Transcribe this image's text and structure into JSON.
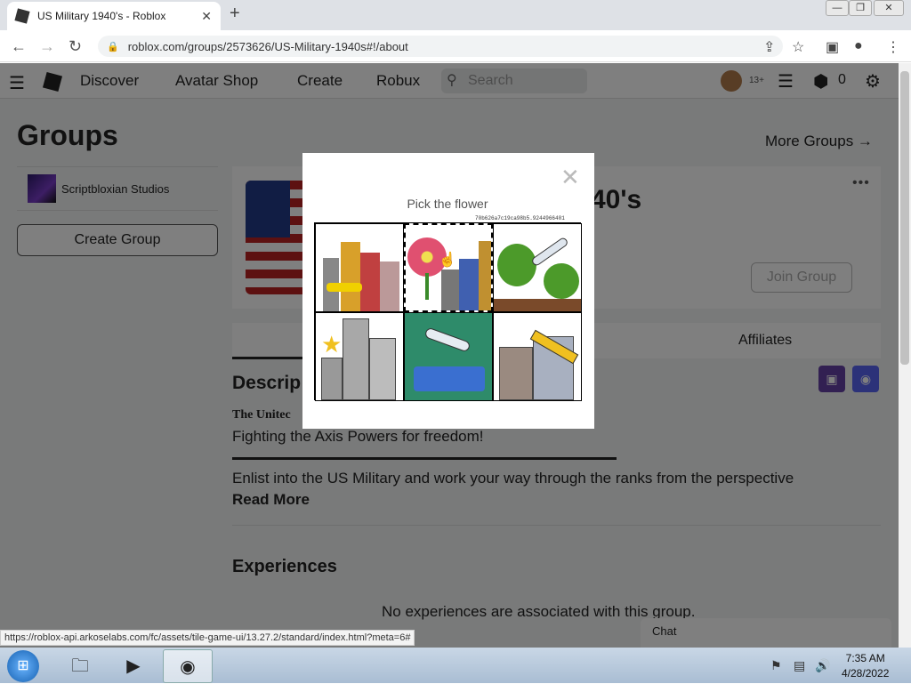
{
  "browser": {
    "tab_title": "US Military 1940's - Roblox",
    "url": "roblox.com/groups/2573626/US-Military-1940s#!/about",
    "status_url": "https://roblox-api.arkoselabs.com/fc/assets/tile-game-ui/13.27.2/standard/index.html?meta=6#"
  },
  "nav": {
    "items": [
      "Discover",
      "Avatar Shop",
      "Create",
      "Robux"
    ],
    "search_placeholder": "Search",
    "age_badge": "13+",
    "robux_count": "0"
  },
  "page": {
    "title": "Groups",
    "more_groups": "More Groups →",
    "sidebar_group": "Scriptbloxian Studios",
    "create_group": "Create Group",
    "group_name_partial": "40's",
    "join_group": "Join Group",
    "affiliates_tab": "Affiliates",
    "description_heading": "Descrip",
    "description_bold": "The Unitec",
    "description_line1": "Fighting the Axis Powers for freedom!",
    "description_line2": "Enlist into the US Military and work your way through the ranks from the perspective",
    "read_more": "Read More",
    "experiences_heading": "Experiences",
    "no_experiences": "No experiences are associated with this group.",
    "chat": "Chat"
  },
  "captcha": {
    "prompt": "Pick the flower",
    "hash": "70b626a7c19ca98b5.9244966401",
    "tiles": [
      {
        "subject": "city-buildings"
      },
      {
        "subject": "flower-city",
        "selected": true
      },
      {
        "subject": "airplane-trees"
      },
      {
        "subject": "buildings-star"
      },
      {
        "subject": "airplane-island"
      },
      {
        "subject": "pencil-factory"
      }
    ]
  },
  "taskbar": {
    "time": "7:35 AM",
    "date": "4/28/2022"
  }
}
